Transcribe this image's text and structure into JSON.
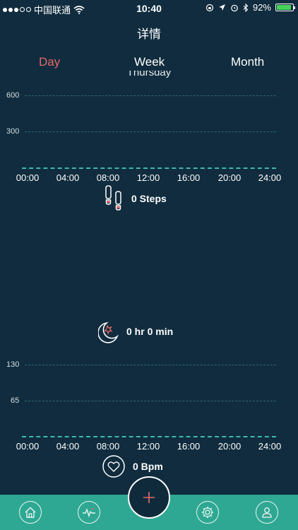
{
  "status_bar": {
    "carrier": "中国联通",
    "time": "10:40",
    "battery_percent": "92%",
    "battery_level": 0.92,
    "battery_color": "#46d35a"
  },
  "nav": {
    "title": "详情"
  },
  "tabs": [
    {
      "label": "Day",
      "active": true
    },
    {
      "label": "Week",
      "active": false
    },
    {
      "label": "Month",
      "active": false
    }
  ],
  "day_label": "Thursday",
  "steps_chart": {
    "y_ticks": [
      "600",
      "300"
    ],
    "x_ticks": [
      "00:00",
      "04:00",
      "08:00",
      "12:00",
      "16:00",
      "20:00",
      "24:00"
    ]
  },
  "steps_summary": {
    "text": "0 Steps"
  },
  "sleep_summary": {
    "text": "0 hr 0 min"
  },
  "heart_chart": {
    "y_ticks": [
      "130",
      "65"
    ],
    "x_ticks": [
      "00:00",
      "04:00",
      "08:00",
      "12:00",
      "16:00",
      "20:00",
      "24:00"
    ]
  },
  "heart_summary": {
    "text": "0 Bpm"
  },
  "colors": {
    "background": "#102c3e",
    "accent_active_tab": "#e8696a",
    "bottom_bar": "#2ea893",
    "grid": "#2f6a78",
    "baseline": "#3fb7b2"
  },
  "bottom_nav": [
    "home-icon",
    "activity-chart-icon",
    "add-icon",
    "gear-icon",
    "user-icon"
  ]
}
